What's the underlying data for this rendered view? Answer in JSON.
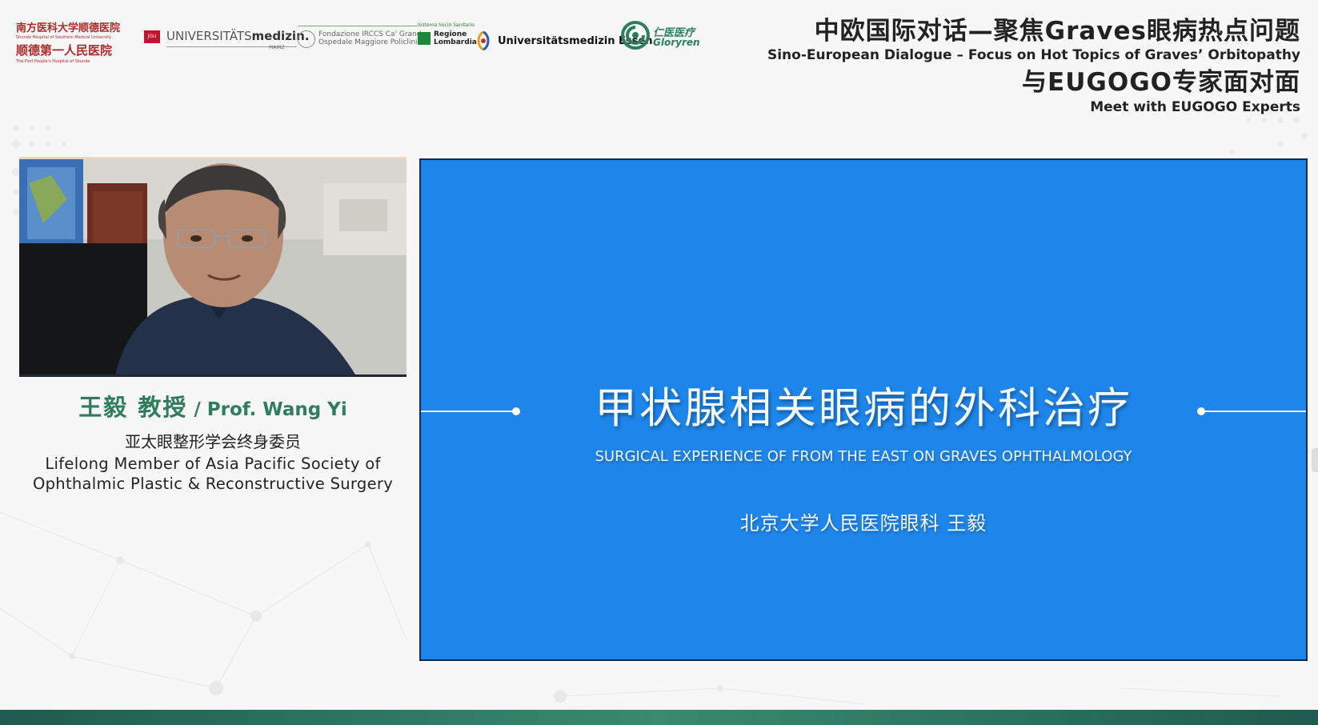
{
  "logos": {
    "shunde": {
      "line1": "南方医科大学顺德医院",
      "line1_sub": "Shunde Hospital of Southern Medical University",
      "line2": "顺德第一人民医院",
      "line2_sub": "The First People's Hospital of Shunde"
    },
    "jgu": {
      "badge": "JGU",
      "text_light": "UNIVERSITÄTS",
      "text_bold": "medizin.",
      "city": "MAINZ"
    },
    "irccs": {
      "line1": "Fondazione IRCCS Ca' Granda",
      "line2": "Ospedale Maggiore Policlinico"
    },
    "lombardia": {
      "top": "Sistema Socio Sanitario",
      "line1": "Regione",
      "line2": "Lombardia"
    },
    "essen": {
      "text": "Universitätsmedizin Essen"
    },
    "gloryren": {
      "cn": "仁医医疗",
      "en": "Gloryren"
    }
  },
  "header": {
    "title_cn_1": "中欧国际对话—聚焦Graves眼病热点问题",
    "title_en_1": "Sino-European Dialogue – Focus on Hot Topics of Graves’ Orbitopathy",
    "title_cn_2": "与EUGOGO专家面对面",
    "title_en_2": "Meet with EUGOGO Experts"
  },
  "speaker": {
    "name_cn": "王毅 教授",
    "name_en": " / Prof. Wang Yi",
    "role_cn": "亚太眼整形学会终身委员",
    "role_en_1": "Lifelong Member of Asia Pacific Society of",
    "role_en_2": "Ophthalmic Plastic & Reconstructive Surgery"
  },
  "slide": {
    "title": "甲状腺相关眼病的外科治疗",
    "subtitle": "SURGICAL EXPERIENCE OF FROM THE EAST ON GRAVES OPHTHALMOLOGY",
    "author": "北京大学人民医院眼科  王毅"
  },
  "colors": {
    "accent_green": "#2e7d5b",
    "slide_blue": "#1e86ea",
    "logo_red": "#b02a2a"
  }
}
